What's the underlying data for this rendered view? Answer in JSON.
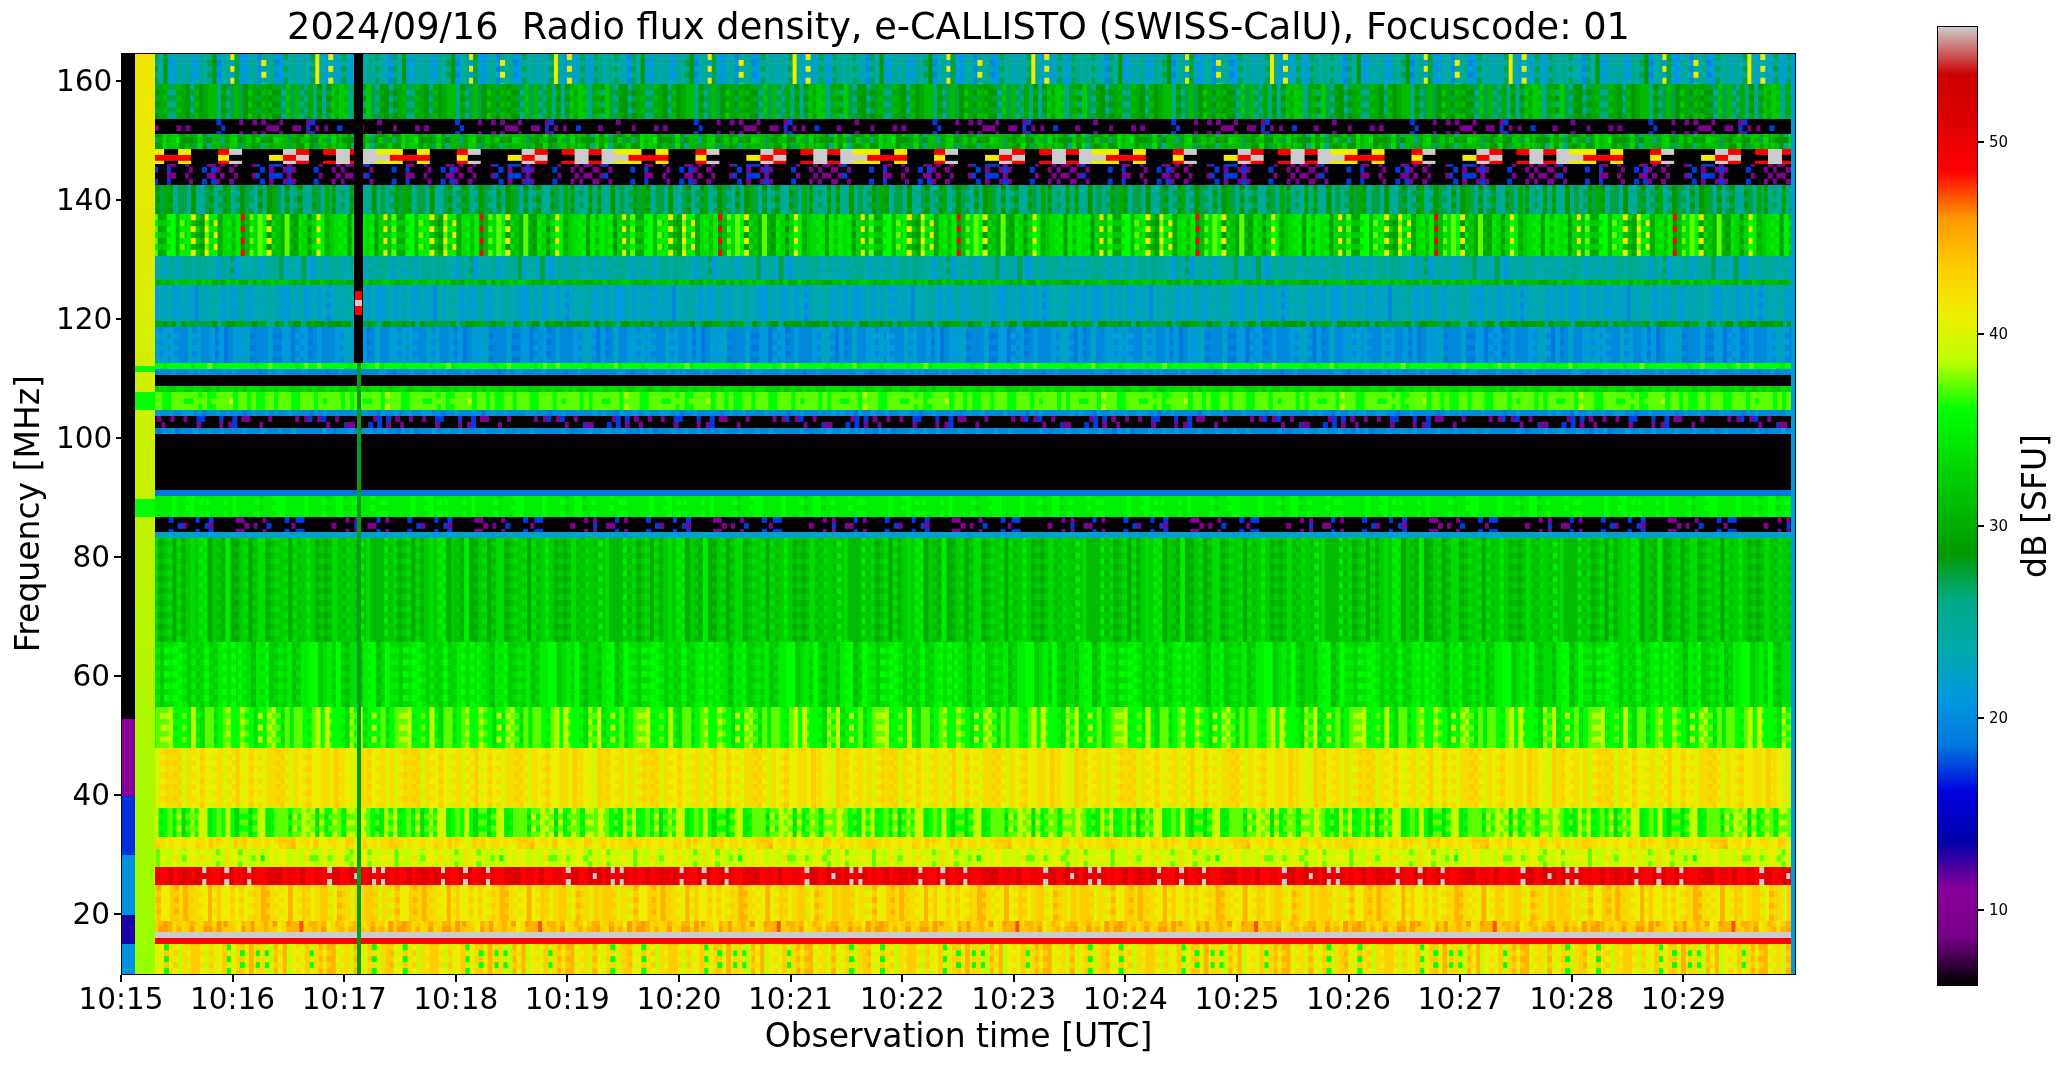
{
  "title": "2024/09/16  Radio flux density, e-CALLISTO (SWISS-CalU), Focuscode: 01",
  "y_axis": {
    "label": "Frequency [MHz]",
    "ticks": [
      "160",
      "140",
      "120",
      "100",
      "80",
      "60",
      "40",
      "20"
    ]
  },
  "x_axis": {
    "label": "Observation time [UTC]",
    "ticks": [
      "10:15",
      "10:16",
      "10:17",
      "10:18",
      "10:19",
      "10:20",
      "10:21",
      "10:22",
      "10:23",
      "10:24",
      "10:25",
      "10:26",
      "10:27",
      "10:28",
      "10:29"
    ]
  },
  "colorbar": {
    "label": "dB [SFU]",
    "ticks": [
      "50",
      "40",
      "30",
      "20",
      "10"
    ]
  }
}
